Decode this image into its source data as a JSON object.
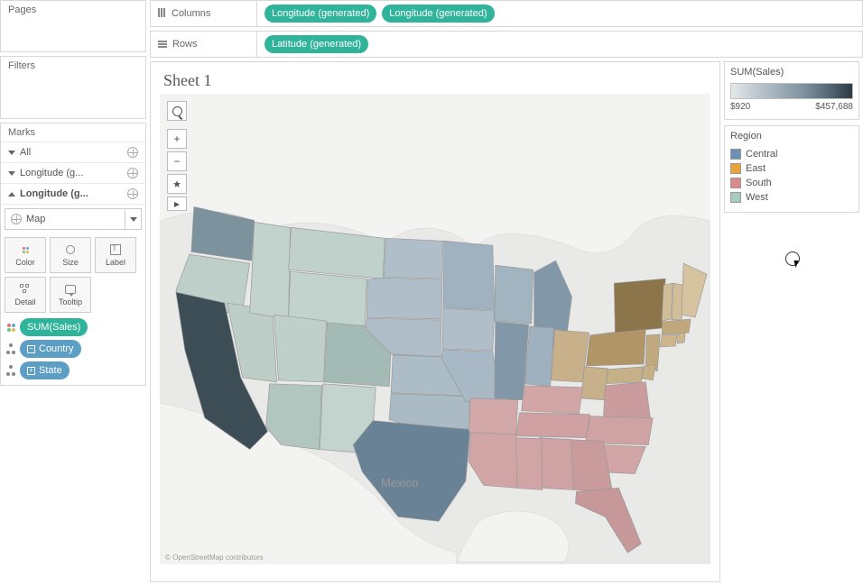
{
  "sidebar": {
    "pages_label": "Pages",
    "filters_label": "Filters",
    "marks_label": "Marks",
    "all_label": "All",
    "longitude1_label": "Longitude (g...",
    "longitude2_label": "Longitude (g...",
    "map_type_label": "Map",
    "buttons": {
      "color": "Color",
      "size": "Size",
      "label": "Label",
      "detail": "Detail",
      "tooltip": "Tooltip"
    },
    "pills": {
      "sum_sales": "SUM(Sales)",
      "country": "Country",
      "state": "State"
    },
    "pill_expand_minus": "−",
    "pill_expand_plus": "+"
  },
  "shelves": {
    "columns_label": "Columns",
    "rows_label": "Rows",
    "longitude_pill": "Longitude (generated)",
    "latitude_pill": "Latitude (generated)"
  },
  "viz": {
    "title": "Sheet 1",
    "zoom_in": "+",
    "zoom_out": "−",
    "mexico": "Mexico",
    "attribution": "© OpenStreetMap contributors"
  },
  "legends": {
    "sales_title": "SUM(Sales)",
    "sales_min": "$920",
    "sales_max": "$457,688",
    "region_title": "Region",
    "regions": {
      "central": "Central",
      "east": "East",
      "south": "South",
      "west": "West"
    }
  },
  "chart_data": {
    "type": "map",
    "title": "Sheet 1",
    "color_field": "SUM(Sales)",
    "color_scale_min": 920,
    "color_scale_max": 457688,
    "group_field": "Region",
    "regions": [
      "Central",
      "East",
      "South",
      "West"
    ],
    "region_colors": {
      "Central": "#6e90b7",
      "East": "#e9a33a",
      "South": "#d88a8d",
      "West": "#a7c9be"
    },
    "states": [
      {
        "state": "Washington",
        "region": "West"
      },
      {
        "state": "Oregon",
        "region": "West"
      },
      {
        "state": "California",
        "region": "West",
        "sales_rank": "highest"
      },
      {
        "state": "Nevada",
        "region": "West"
      },
      {
        "state": "Idaho",
        "region": "West"
      },
      {
        "state": "Montana",
        "region": "West"
      },
      {
        "state": "Wyoming",
        "region": "West"
      },
      {
        "state": "Utah",
        "region": "West"
      },
      {
        "state": "Colorado",
        "region": "West"
      },
      {
        "state": "Arizona",
        "region": "West"
      },
      {
        "state": "New Mexico",
        "region": "West"
      },
      {
        "state": "North Dakota",
        "region": "Central"
      },
      {
        "state": "South Dakota",
        "region": "Central"
      },
      {
        "state": "Nebraska",
        "region": "Central"
      },
      {
        "state": "Kansas",
        "region": "Central"
      },
      {
        "state": "Oklahoma",
        "region": "Central"
      },
      {
        "state": "Texas",
        "region": "Central"
      },
      {
        "state": "Minnesota",
        "region": "Central"
      },
      {
        "state": "Iowa",
        "region": "Central"
      },
      {
        "state": "Missouri",
        "region": "Central"
      },
      {
        "state": "Wisconsin",
        "region": "Central"
      },
      {
        "state": "Illinois",
        "region": "Central"
      },
      {
        "state": "Michigan",
        "region": "Central"
      },
      {
        "state": "Indiana",
        "region": "Central"
      },
      {
        "state": "Ohio",
        "region": "East"
      },
      {
        "state": "Kentucky",
        "region": "South"
      },
      {
        "state": "Tennessee",
        "region": "South"
      },
      {
        "state": "Mississippi",
        "region": "South"
      },
      {
        "state": "Alabama",
        "region": "South"
      },
      {
        "state": "Georgia",
        "region": "South"
      },
      {
        "state": "Florida",
        "region": "South"
      },
      {
        "state": "South Carolina",
        "region": "South"
      },
      {
        "state": "North Carolina",
        "region": "South"
      },
      {
        "state": "Virginia",
        "region": "South"
      },
      {
        "state": "West Virginia",
        "region": "East"
      },
      {
        "state": "Arkansas",
        "region": "South"
      },
      {
        "state": "Louisiana",
        "region": "South"
      },
      {
        "state": "Maine",
        "region": "East"
      },
      {
        "state": "New Hampshire",
        "region": "East"
      },
      {
        "state": "Vermont",
        "region": "East"
      },
      {
        "state": "Massachusetts",
        "region": "East"
      },
      {
        "state": "Rhode Island",
        "region": "East"
      },
      {
        "state": "Connecticut",
        "region": "East"
      },
      {
        "state": "New York",
        "region": "East",
        "sales_rank": "high"
      },
      {
        "state": "New Jersey",
        "region": "East"
      },
      {
        "state": "Pennsylvania",
        "region": "East"
      },
      {
        "state": "Delaware",
        "region": "East"
      },
      {
        "state": "Maryland",
        "region": "East"
      }
    ]
  }
}
